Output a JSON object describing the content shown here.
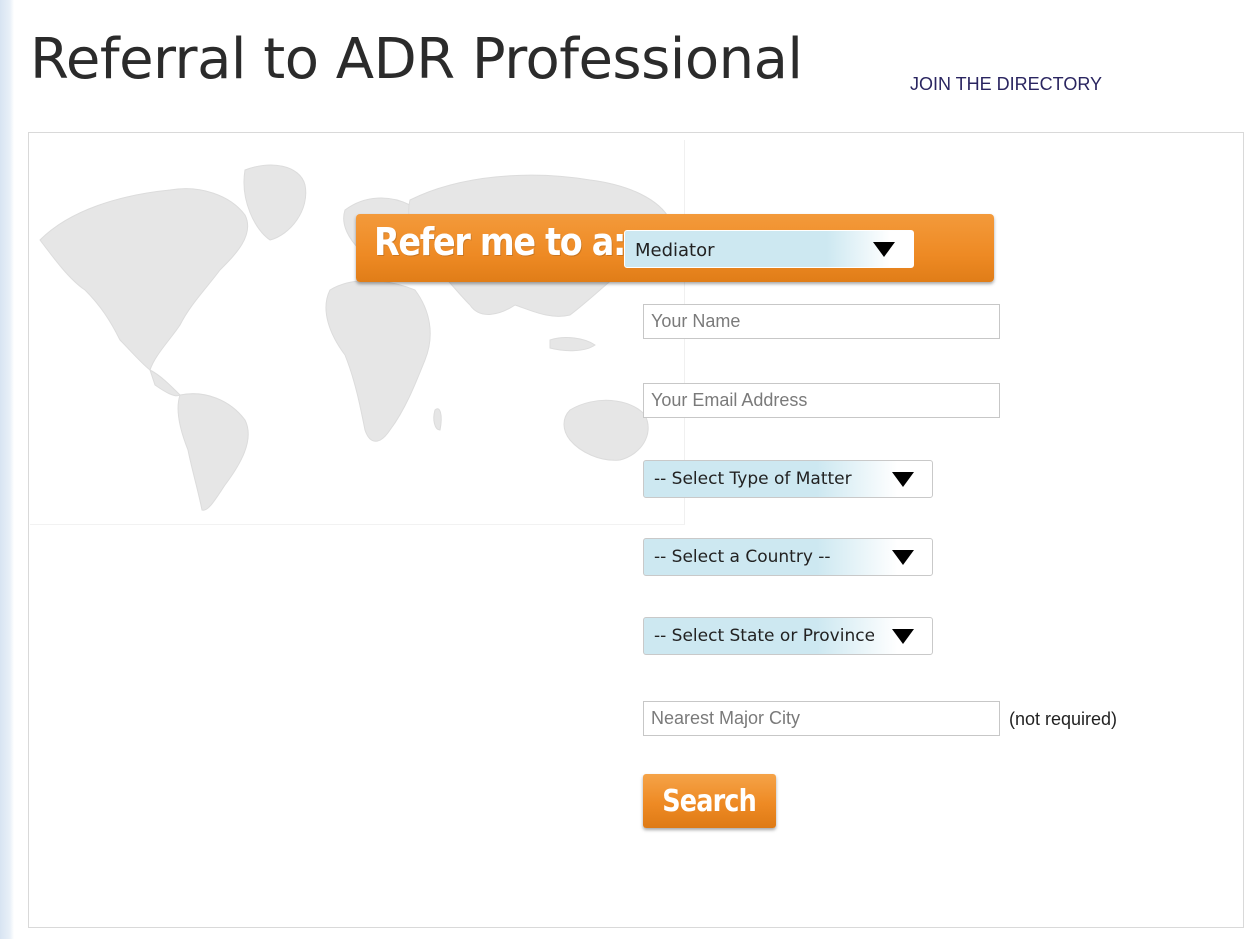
{
  "header": {
    "title": "Referral to ADR Professional",
    "join_link": "JOIN THE DIRECTORY"
  },
  "refer": {
    "label": "Refer me to a:",
    "professional_type": "Mediator"
  },
  "form": {
    "name_placeholder": "Your Name",
    "email_placeholder": "Your Email Address",
    "matter_select": "-- Select Type of Matter",
    "country_select": "-- Select a Country --",
    "state_select": "-- Select State or Province",
    "city_placeholder": "Nearest Major City",
    "city_note": "(not required)",
    "search_label": "Search"
  },
  "colors": {
    "accent_orange": "#ee8a24",
    "select_blue": "#cde8f1",
    "link_color": "#2a2560"
  }
}
